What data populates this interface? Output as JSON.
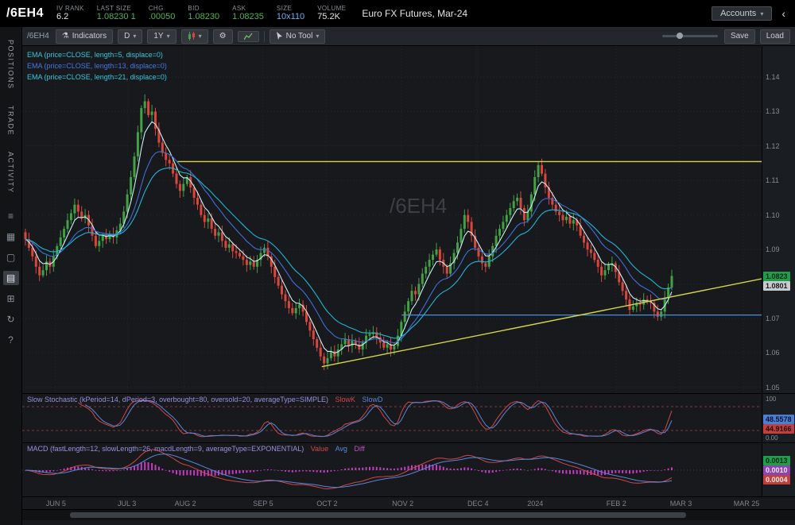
{
  "topbar": {
    "symbol": "/6EH4",
    "fields": [
      {
        "label": "IV Rank",
        "value": "6.2"
      },
      {
        "label": "Last Size",
        "value": "1.08230 1"
      },
      {
        "label": "Chg",
        "value": ".00050"
      },
      {
        "label": "Bid",
        "value": "1.08230"
      },
      {
        "label": "Ask",
        "value": "1.08235"
      },
      {
        "label": "Size",
        "value": "10x110"
      },
      {
        "label": "Volume",
        "value": "75.2K"
      }
    ],
    "description": "Euro FX Futures, Mar-24",
    "accounts_label": "Accounts",
    "collapse_glyph": "‹"
  },
  "sidebar": {
    "tabs": [
      "POSITIONS",
      "TRADE",
      "ACTIVITY"
    ],
    "icons": [
      {
        "name": "watchlist-icon",
        "glyph": "≡",
        "active": false
      },
      {
        "name": "grid-icon",
        "glyph": "▦",
        "active": false
      },
      {
        "name": "monitor-icon",
        "glyph": "▢",
        "active": false
      },
      {
        "name": "chart-tile-icon",
        "glyph": "▤",
        "active": true
      },
      {
        "name": "apps-icon",
        "glyph": "⊞",
        "active": false
      },
      {
        "name": "history-icon",
        "glyph": "↻",
        "active": false
      },
      {
        "name": "help-icon",
        "glyph": "?",
        "active": false
      }
    ]
  },
  "toolbar": {
    "symbol": "/6EH4",
    "indicators_label": "Indicators",
    "timeframe": "D",
    "range": "1Y",
    "tool_label": "No Tool",
    "save_label": "Save",
    "load_label": "Load"
  },
  "studies": {
    "ema_labels": [
      "EMA (price=CLOSE, length=5, displace=0)",
      "EMA (price=CLOSE, length=13, displace=0)",
      "EMA (price=CLOSE, length=21, displace=0)"
    ],
    "stoch_label": "Slow Stochastic (kPeriod=14, dPeriod=3, overbought=80, oversold=20, averageType=SIMPLE)",
    "stoch_legend": [
      "SlowK",
      "SlowD"
    ],
    "macd_label": "MACD (fastLength=12, slowLength=26, macdLength=9, averageType=EXPONENTIAL)",
    "macd_legend": [
      "Value",
      "Avg",
      "Diff"
    ]
  },
  "chart_data": {
    "type": "candlestick",
    "symbol_watermark": "/6EH4",
    "instrument": "Euro FX Futures, Mar-24",
    "ylim": [
      1.0481,
      1.149
    ],
    "y_ticks": [
      1.05,
      1.06,
      1.07,
      1.08,
      1.09,
      1.1,
      1.11,
      1.12,
      1.13,
      1.14
    ],
    "x_labels": [
      {
        "text": "JUN 5",
        "frac": 0.045
      },
      {
        "text": "JUL 3",
        "frac": 0.142
      },
      {
        "text": "AUG 2",
        "frac": 0.219
      },
      {
        "text": "SEP 5",
        "frac": 0.325
      },
      {
        "text": "OCT 2",
        "frac": 0.411
      },
      {
        "text": "NOV 2",
        "frac": 0.513
      },
      {
        "text": "DEC 4",
        "frac": 0.615
      },
      {
        "text": "2024",
        "frac": 0.696
      },
      {
        "text": "FEB 2",
        "frac": 0.803
      },
      {
        "text": "MAR 3",
        "frac": 0.889
      },
      {
        "text": "MAR 25",
        "frac": 0.975
      }
    ],
    "open_first": 1.095,
    "closes": [
      1.093,
      1.0905,
      1.088,
      1.085,
      1.0825,
      1.084,
      1.0865,
      1.085,
      1.088,
      1.091,
      1.0935,
      1.096,
      1.0985,
      1.1005,
      1.103,
      1.101,
      1.099,
      1.1,
      1.097,
      1.094,
      1.091,
      1.0925,
      1.094,
      1.093,
      1.0945,
      1.0935,
      1.0955,
      1.0975,
      1.101,
      1.106,
      1.111,
      1.117,
      1.124,
      1.131,
      1.133,
      1.129,
      1.13,
      1.125,
      1.121,
      1.118,
      1.116,
      1.115,
      1.112,
      1.109,
      1.107,
      1.109,
      1.111,
      1.108,
      1.105,
      1.103,
      1.1,
      1.098,
      1.099,
      1.096,
      1.094,
      1.095,
      1.0925,
      1.0905,
      1.0915,
      1.0895,
      1.089,
      1.088,
      1.087,
      1.0855,
      1.0865,
      1.085,
      1.087,
      1.089,
      1.0905,
      1.088,
      1.085,
      1.082,
      1.0795,
      1.077,
      1.075,
      1.073,
      1.0715,
      1.073,
      1.074,
      1.072,
      1.069,
      1.0665,
      1.064,
      1.0615,
      1.059,
      1.057,
      1.0585,
      1.0605,
      1.059,
      1.061,
      1.0625,
      1.064,
      1.062,
      1.0635,
      1.0625,
      1.061,
      1.063,
      1.065,
      1.0655,
      1.066,
      1.0645,
      1.063,
      1.0615,
      1.0625,
      1.061,
      1.062,
      1.065,
      1.069,
      1.072,
      1.075,
      1.078,
      1.077,
      1.08,
      1.083,
      1.085,
      1.087,
      1.0885,
      1.09,
      1.087,
      1.085,
      1.083,
      1.086,
      1.089,
      1.092,
      1.096,
      1.1,
      1.098,
      1.094,
      1.0905,
      1.088,
      1.086,
      1.085,
      1.088,
      1.091,
      1.094,
      1.096,
      1.098,
      1.1,
      1.102,
      1.104,
      1.105,
      1.102,
      1.0985,
      1.101,
      1.106,
      1.111,
      1.1145,
      1.112,
      1.108,
      1.105,
      1.103,
      1.101,
      1.1,
      1.0985,
      1.0995,
      1.0975,
      1.0985,
      1.097,
      1.094,
      1.092,
      1.09,
      1.089,
      1.087,
      1.085,
      1.0825,
      1.084,
      1.0855,
      1.086,
      1.0835,
      1.0805,
      1.078,
      1.0755,
      1.0725,
      1.0735,
      1.0745,
      1.074,
      1.0755,
      1.075,
      1.0745,
      1.072,
      1.0705,
      1.072,
      1.076,
      1.079,
      1.0823
    ],
    "ema_periods": [
      5,
      13,
      21
    ],
    "drawings": {
      "resistance_line": {
        "price": 1.1155,
        "x_start_frac": 0.21,
        "color": "#d6d64a"
      },
      "support_line": {
        "price": 1.071,
        "x_start_frac": 0.513,
        "color": "#4a90d9"
      },
      "trendline": {
        "x1_frac": 0.405,
        "price1": 1.056,
        "x2_frac": 1.0,
        "price2": 1.0815,
        "color": "#d6d64a"
      }
    },
    "axis_badges": [
      {
        "text": "1.0823",
        "price": 1.0823,
        "color": "#1f9d4d",
        "fg": "#07240f"
      },
      {
        "text": "1.0801",
        "price": 1.0801,
        "color": "#c7cbd0",
        "fg": "#17191d"
      }
    ],
    "stochastic": {
      "k_period": 14,
      "d_period": 3,
      "overbought": 80,
      "oversold": 20,
      "axis_top": "100",
      "axis_bottom": "0.00",
      "badges": [
        {
          "text": "48.5578",
          "v": 48.56,
          "color": "#4b7fd6",
          "fg": "#0a1628"
        },
        {
          "text": "44.9166",
          "v": 42.3,
          "color": "#c04040",
          "fg": "#250808"
        }
      ]
    },
    "macd": {
      "fast": 12,
      "slow": 26,
      "signal": 9,
      "badges": [
        {
          "text": "0.0013",
          "color": "#1f9d4d",
          "fg": "#07240f"
        },
        {
          "text": "0.0010",
          "color": "#8e44ad",
          "fg": "#f0e6f6"
        },
        {
          "text": "0.0004",
          "color": "#c04040",
          "fg": "#f6e6e6"
        }
      ]
    },
    "colors": {
      "up": "#43a047",
      "down": "#d9473c",
      "ema5": "#cdeef3",
      "ema13": "#3f6fd8",
      "ema21": "#1fb6d4",
      "slowK": "#d04848",
      "slowD": "#5a86d8",
      "macd_value": "#d04848",
      "macd_avg": "#5a86d8",
      "macd_diff": "#c43bc4",
      "grid": "#24292e",
      "watermark": "#3a4046"
    }
  }
}
